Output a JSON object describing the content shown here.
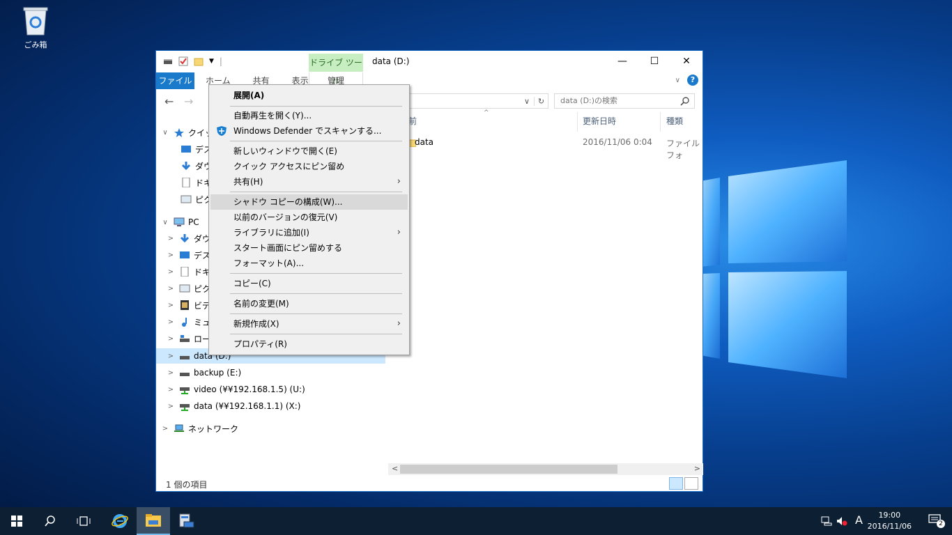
{
  "desktop": {
    "recycle_bin_label": "ごみ箱"
  },
  "window": {
    "title": "data (D:)",
    "drive_tools_tab": "ドライブ ツール",
    "ribbon_tabs": {
      "file": "ファイル",
      "home": "ホーム",
      "share": "共有",
      "view": "表示",
      "manage": "管理"
    },
    "search_placeholder": "data (D:)の検索",
    "columns": {
      "name": "前",
      "modified": "更新日時",
      "type": "種類"
    },
    "files": [
      {
        "name": "data",
        "modified": "2016/11/06 0:04",
        "type": "ファイル フォ"
      }
    ],
    "status": "1 個の項目"
  },
  "nav_pane": {
    "quick_access": "クイック",
    "quick_items": [
      "デスク",
      "ダウン",
      "ドキュ",
      "ピクチ"
    ],
    "pc": "PC",
    "pc_items": [
      "ダウン",
      "デスク",
      "ドキュ",
      "ピクチ",
      "ビデオ",
      "ミュー",
      "ローカ"
    ],
    "drives": [
      {
        "label": "data (D:)",
        "selected": true
      },
      {
        "label": "backup (E:)",
        "selected": false
      },
      {
        "label": "video (¥¥192.168.1.5) (U:)",
        "selected": false
      },
      {
        "label": "data (¥¥192.168.1.1) (X:)",
        "selected": false
      }
    ],
    "network": "ネットワーク"
  },
  "context_menu": {
    "items": [
      "展開(A)",
      "自動再生を開く(Y)...",
      "Windows Defender でスキャンする...",
      "新しいウィンドウで開く(E)",
      "クイック アクセスにピン留め",
      "共有(H)",
      "シャドウ コピーの構成(W)...",
      "以前のバージョンの復元(V)",
      "ライブラリに追加(I)",
      "スタート画面にピン留めする",
      "フォーマット(A)...",
      "コピー(C)",
      "名前の変更(M)",
      "新規作成(X)",
      "プロパティ(R)"
    ],
    "hovered_item": "シャドウ コピーの構成(W)..."
  },
  "taskbar": {
    "time": "19:00",
    "date": "2016/11/06",
    "ime": "A",
    "notifications": "2"
  },
  "colors": {
    "accent": "#1979ca",
    "drive_tools": "#c6eec0",
    "selection": "#cce8ff",
    "taskbar": "#0c1f33"
  }
}
